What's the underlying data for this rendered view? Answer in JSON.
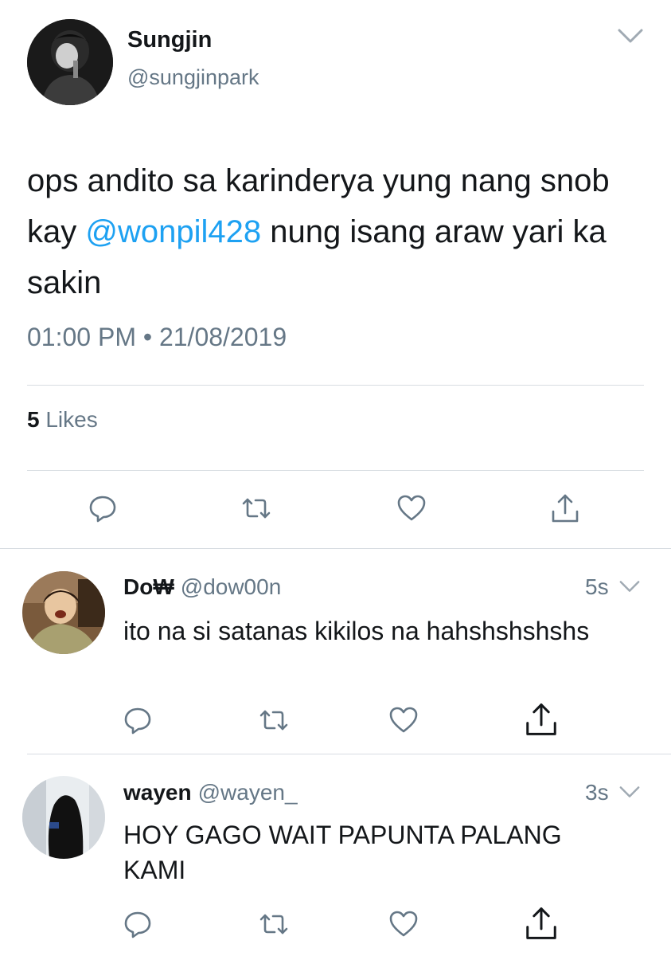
{
  "main_tweet": {
    "author_name": "Sungjin",
    "author_handle": "@sungjinpark",
    "text_before_mention": "ops andito sa karinderya yung nang snob kay ",
    "mention": "@wonpil428",
    "text_after_mention": " nung isang araw yari ka sakin",
    "timestamp": "01:00 PM • 21/08/2019",
    "likes_count": "5",
    "likes_label": " Likes"
  },
  "replies": [
    {
      "author_name": "Do₩",
      "author_handle": "@dow00n",
      "time": "5s",
      "text": "ito na si satanas kikilos na hahshshshshs"
    },
    {
      "author_name": "wayen",
      "author_handle": "@wayen_",
      "time": "3s",
      "text": "HOY GAGO WAIT PAPUNTA PALANG KAMI"
    }
  ],
  "icons": {
    "reply": "reply-icon",
    "retweet": "retweet-icon",
    "like": "heart-icon",
    "share": "share-icon",
    "menu": "chevron-down-icon"
  },
  "colors": {
    "text": "#14171a",
    "secondary": "#657786",
    "link": "#1da1f2",
    "divider": "#d8dde2",
    "icon": "#657786"
  }
}
